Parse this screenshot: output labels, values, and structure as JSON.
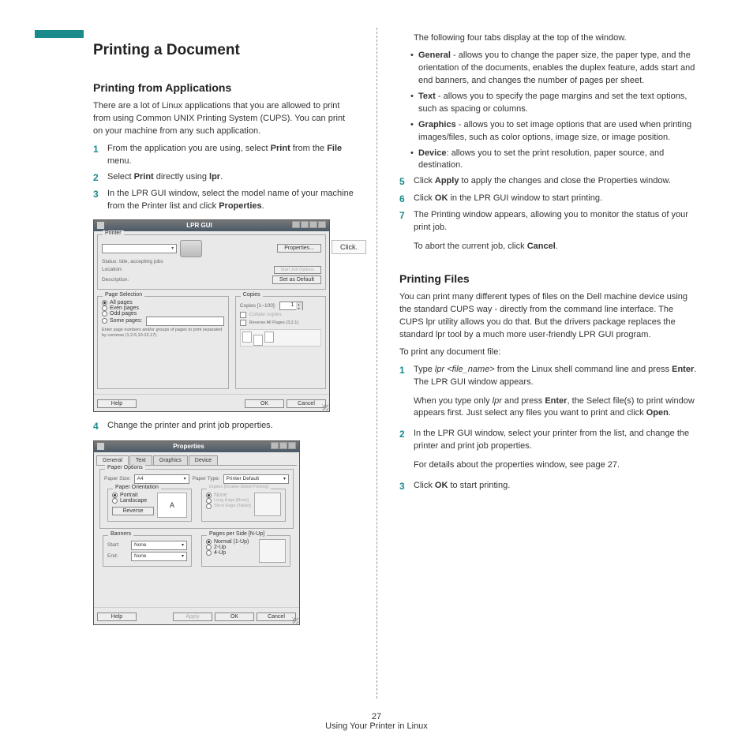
{
  "page": {
    "title": "Printing a Document",
    "h2_apps": "Printing from Applications",
    "intro_apps": "There are a lot of Linux applications that you are allowed to print from using Common UNIX Printing System (CUPS). You can print on your machine from any such application.",
    "step1_a": "From the application you are using, select ",
    "step1_b": "Print",
    "step1_c": " from the ",
    "step1_d": "File",
    "step1_e": " menu.",
    "step2_a": "Select ",
    "step2_b": "Print",
    "step2_c": " directly using ",
    "step2_d": "lpr",
    "step2_e": ".",
    "step3_a": "In the LPR GUI window, select the model name of your machine from the Printer list and click ",
    "step3_b": "Properties",
    "step3_c": ".",
    "callout": "Click.",
    "step4": "Change the printer and print job properties.",
    "tabs_intro": "The following four tabs display at the top of the window.",
    "tab_general_a": "General",
    "tab_general_b": " - allows you to change the paper size, the paper type, and the orientation of the documents, enables the duplex feature, adds start and end banners, and changes the number of pages per sheet.",
    "tab_text_a": "Text",
    "tab_text_b": " - allows you to specify the page margins and set the text options, such as spacing or columns.",
    "tab_graphics_a": "Graphics",
    "tab_graphics_b": " - allows you to set image options that are used when printing images/files, such as color options, image size, or image position.",
    "tab_device_a": "Device",
    "tab_device_b": ": allows you to set the print resolution, paper source, and destination.",
    "step5_a": "Click ",
    "step5_b": "Apply",
    "step5_c": " to apply the changes and close the Properties window.",
    "step6_a": "Click ",
    "step6_b": "OK",
    "step6_c": " in the LPR GUI window to start printing.",
    "step7_a": "The Printing window appears, allowing you to monitor the status of your print job.",
    "step7_sub_a": "To abort the current job, click ",
    "step7_sub_b": "Cancel",
    "step7_sub_c": ".",
    "h2_files": "Printing Files",
    "files_intro": "You can print many different types of files on the Dell machine device using the standard CUPS way - directly from the command line interface. The CUPS lpr utility allows you do that. But the drivers package replaces the standard lpr tool by a much more user-friendly LPR GUI program.",
    "files_lead": "To print any document file:",
    "f1_a": "Type ",
    "f1_b": "lpr <file_name>",
    "f1_c": " from the Linux shell command line and press ",
    "f1_d": "Enter",
    "f1_e": ". The LPR GUI window appears.",
    "f1_sub_a": "When you type only ",
    "f1_sub_b": "lpr",
    "f1_sub_c": " and press ",
    "f1_sub_d": "Enter",
    "f1_sub_e": ", the Select file(s) to print window appears first. Just select any files you want to print and click ",
    "f1_sub_f": "Open",
    "f1_sub_g": ".",
    "f2_a": "In the LPR GUI window, select your printer from the list, and change the printer and print job properties.",
    "f2_sub": "For details about the properties window, see page 27.",
    "f3_a": "Click ",
    "f3_b": "OK",
    "f3_c": " to start printing.",
    "page_num": "27",
    "footer": "Using Your Printer in Linux"
  },
  "lpr": {
    "title": "LPR GUI",
    "printer_legend": "Printer",
    "status": "Status: Idle, accepting jobs",
    "location": "Location:",
    "description": "Description:",
    "properties_btn": "Properties...",
    "start_job": "Start Job Options",
    "set_default": "Set as Default",
    "page_sel_legend": "Page Selection",
    "all_pages": "All pages",
    "even_pages": "Even pages",
    "odd_pages": "Odd pages",
    "some_pages": "Some pages:",
    "page_hint": "Enter page numbers and/or groups of pages to print separated by commas (1,2-5,10-12,17).",
    "copies_legend": "Copies",
    "copies_label": "Copies [1~100]:",
    "copies_val": "1",
    "collate": "Collate copies",
    "reverse": "Reverse All Pages (3,2,1)",
    "help": "Help",
    "ok": "OK",
    "cancel": "Cancel"
  },
  "prop": {
    "title": "Properties",
    "tab_general": "General",
    "tab_text": "Text",
    "tab_graphics": "Graphics",
    "tab_device": "Device",
    "paper_options": "Paper Options",
    "paper_size": "Paper Size:",
    "paper_size_val": "A4",
    "paper_type": "Paper Type:",
    "paper_type_val": "Printer Default",
    "orient_legend": "Paper Orientation",
    "portrait": "Portrait",
    "landscape": "Landscape",
    "reverse": "Reverse",
    "duplex_legend": "Duplex [Double-Sided Printing]",
    "duplex_none": "None",
    "duplex_long": "Long Edge [Book]",
    "duplex_short": "Short Edge [Tablet]",
    "banners": "Banners",
    "start": "Start:",
    "end": "End:",
    "none": "None",
    "nup_legend": "Pages per Side [N-Up]",
    "nup1": "Normal (1-Up)",
    "nup2": "2-Up",
    "nup4": "4-Up",
    "help": "Help",
    "apply": "Apply",
    "ok": "OK",
    "cancel": "Cancel"
  }
}
